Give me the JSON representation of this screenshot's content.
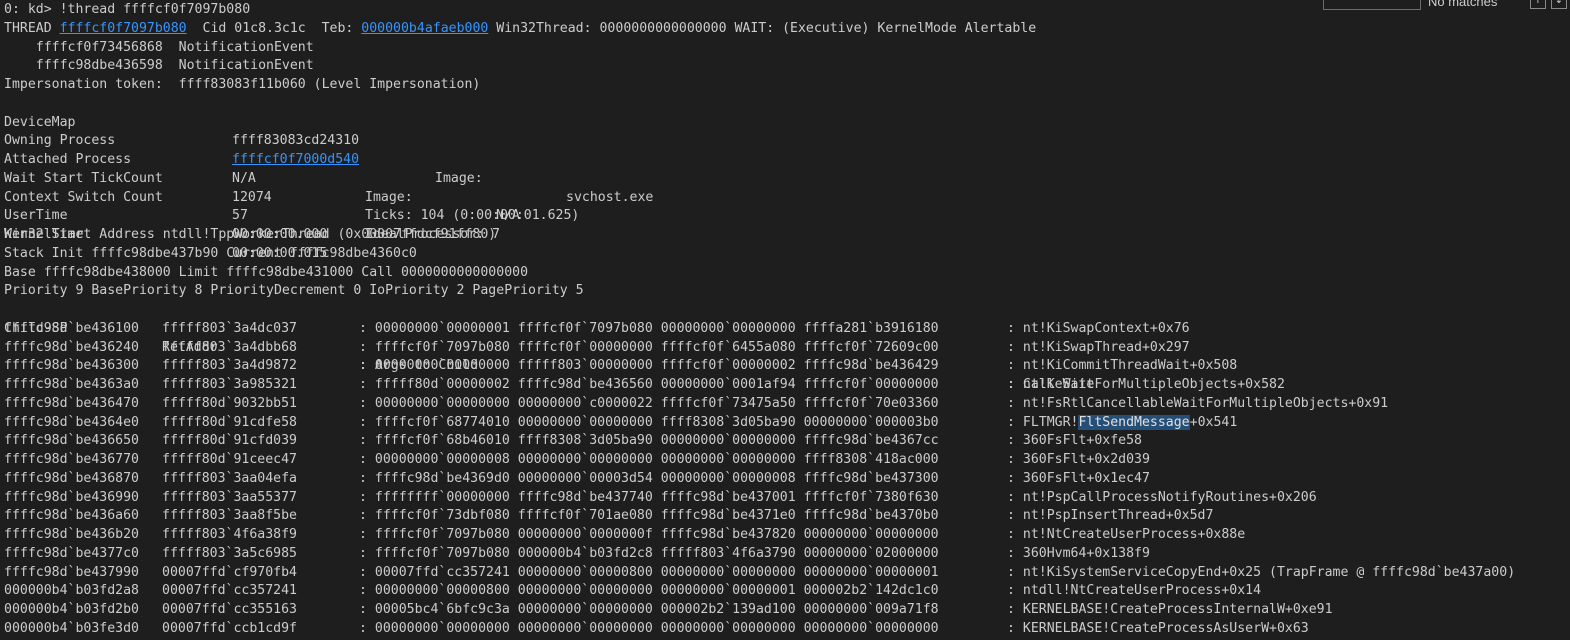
{
  "find_widget": {
    "result_text": "No matches",
    "prev_icon": "arrow-up",
    "next_icon": "arrow-down"
  },
  "header": {
    "prompt": "0: kd> ",
    "command": "!thread ffffcf0f7097b080",
    "thread_prefix": "THREAD ",
    "thread_addr": "ffffcf0f7097b080",
    "cid_teb": "  Cid 01c8.3c1c  Teb: ",
    "teb_addr": "000000b4afaeb000",
    "thread_rest": " Win32Thread: 0000000000000000 WAIT: (Executive) KernelMode Alertable",
    "events": [
      "    ffffcf0f73456868  NotificationEvent",
      "    ffffc98dbe436598  NotificationEvent"
    ],
    "impersonation": "Impersonation token:  ffff83083f11b060 (Level Impersonation)"
  },
  "info": {
    "devicemap_label": "DeviceMap",
    "devicemap_value": "ffff83083cd24310",
    "owning_label": "Owning Process",
    "owning_addr": "ffffcf0f7000d540",
    "image_label": "Image:",
    "image_value": "svchost.exe",
    "attached_label": "Attached Process",
    "attached_value": "N/A",
    "attached_image_label": "Image:",
    "attached_image_value": "N/A",
    "wait_label": "Wait Start TickCount",
    "wait_value": "12074",
    "ticks_text": "Ticks: 104 (0:00:00:01.625)",
    "ctx_label": "Context Switch Count",
    "ctx_value": "57",
    "ideal_text": "IdealProcessor: 7",
    "user_label": "UserTime",
    "user_value": "00:00:00.000",
    "kernel_label": "KernelTime",
    "kernel_value": "00:00:00.015"
  },
  "summary": [
    "Win32 Start Address ntdll!TppWorkerThread (0x00007ffdcf91ff80)",
    "Stack Init ffffc98dbe437b90 Current ffffc98dbe4360c0",
    "Base ffffc98dbe438000 Limit ffffc98dbe431000 Call 0000000000000000",
    "Priority 9 BasePriority 8 PriorityDecrement 0 IoPriority 2 PagePriority 5"
  ],
  "stack": {
    "headers": [
      "Child-SP",
      "RetAddr",
      ": Args to Child",
      ": Call Site"
    ],
    "rows": [
      {
        "sp": "ffffc98d`be436100",
        "ret": "fffff803`3a4dc037",
        "args": ": 00000000`00000001 ffffcf0f`7097b080 00000000`00000000 ffffa281`b3916180",
        "site": ": nt!KiSwapContext+0x76"
      },
      {
        "sp": "ffffc98d`be436240",
        "ret": "fffff803`3a4dbb68",
        "args": ": ffffcf0f`7097b080 ffffcf0f`00000000 ffffcf0f`6455a080 ffffcf0f`72609c00",
        "site": ": nt!KiSwapThread+0x297"
      },
      {
        "sp": "ffffc98d`be436300",
        "ret": "fffff803`3a4d9872",
        "args": ": 00000000`00000000 fffff803`00000000 ffffcf0f`00000002 ffffc98d`be436429",
        "site": ": nt!KiCommitThreadWait+0x508"
      },
      {
        "sp": "ffffc98d`be4363a0",
        "ret": "fffff803`3a985321",
        "args": ": fffff80d`00000002 ffffc98d`be436560 00000000`0001af94 ffffcf0f`00000000",
        "site": ": nt!KeWaitForMultipleObjects+0x582"
      },
      {
        "sp": "ffffc98d`be436470",
        "ret": "fffff80d`9032bb51",
        "args": ": 00000000`00000000 00000000`c0000022 ffffcf0f`73475a50 ffffcf0f`70e03360",
        "site": ": nt!FsRtlCancellableWaitForMultipleObjects+0x91"
      },
      {
        "sp": "ffffc98d`be4364e0",
        "ret": "fffff80d`91cdfe58",
        "args": ": ffffcf0f`68774010 00000000`00000000 ffff8308`3d05ba90 00000000`000003b0",
        "site": ": FLTMGR!",
        "site_hl": "FltSendMessage",
        "site_tail": "+0x541"
      },
      {
        "sp": "ffffc98d`be436650",
        "ret": "fffff80d`91cfd039",
        "args": ": ffffcf0f`68b46010 ffff8308`3d05ba90 00000000`00000000 ffffc98d`be4367cc",
        "site": ": 360FsFlt+0xfe58"
      },
      {
        "sp": "ffffc98d`be436770",
        "ret": "fffff80d`91ceec47",
        "args": ": 00000000`00000008 00000000`00000000 00000000`00000000 ffff8308`418ac000",
        "site": ": 360FsFlt+0x2d039"
      },
      {
        "sp": "ffffc98d`be436870",
        "ret": "fffff803`3aa04efa",
        "args": ": ffffc98d`be4369d0 00000000`00003d54 00000000`00000008 ffffc98d`be437300",
        "site": ": 360FsFlt+0x1ec47"
      },
      {
        "sp": "ffffc98d`be436990",
        "ret": "fffff803`3aa55377",
        "args": ": ffffffff`00000000 ffffc98d`be437740 ffffc98d`be437001 ffffcf0f`7380f630",
        "site": ": nt!PspCallProcessNotifyRoutines+0x206"
      },
      {
        "sp": "ffffc98d`be436a60",
        "ret": "fffff803`3aa8f5be",
        "args": ": ffffcf0f`73dbf080 ffffcf0f`701ae080 ffffc98d`be4371e0 ffffc98d`be4370b0",
        "site": ": nt!PspInsertThread+0x5d7"
      },
      {
        "sp": "ffffc98d`be436b20",
        "ret": "fffff803`4f6a38f9",
        "args": ": ffffcf0f`7097b080 00000000`0000000f ffffc98d`be437820 00000000`00000000",
        "site": ": nt!NtCreateUserProcess+0x88e"
      },
      {
        "sp": "ffffc98d`be4377c0",
        "ret": "fffff803`3a5c6985",
        "args": ": ffffcf0f`7097b080 000000b4`b03fd2c8 fffff803`4f6a3790 00000000`02000000",
        "site": ": 360Hvm64+0x138f9"
      },
      {
        "sp": "ffffc98d`be437990",
        "ret": "00007ffd`cf970fb4",
        "args": ": 00007ffd`cc357241 00000000`00000800 00000000`00000000 00000000`00000001",
        "site": ": nt!KiSystemServiceCopyEnd+0x25 (TrapFrame @ ffffc98d`be437a00)"
      },
      {
        "sp": "000000b4`b03fd2a8",
        "ret": "00007ffd`cc357241",
        "args": ": 00000000`00000800 00000000`00000000 00000000`00000001 000002b2`142dc1c0",
        "site": ": ntdll!NtCreateUserProcess+0x14"
      },
      {
        "sp": "000000b4`b03fd2b0",
        "ret": "00007ffd`cc355163",
        "args": ": 00005bc4`6bfc9c3a 00000000`00000000 000002b2`139ad100 00000000`009a71f8",
        "site": ": KERNELBASE!CreateProcessInternalW+0xe91"
      },
      {
        "sp": "000000b4`b03fe3d0",
        "ret": "00007ffd`ccb1cd9f",
        "args": ": 00000000`00000000 00000000`00000000 00000000`00000000 00000000`00000000",
        "site": ": KERNELBASE!CreateProcessAsUserW+0x63"
      }
    ]
  }
}
